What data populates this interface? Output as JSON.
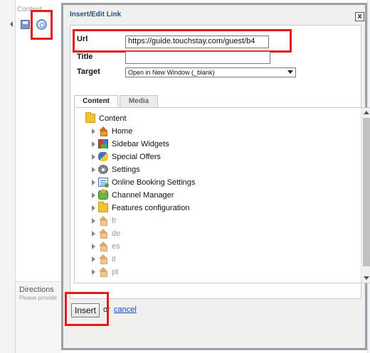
{
  "background": {
    "tab_label": "Content",
    "directions_title": "Directions",
    "directions_hint": "Please provide"
  },
  "dialog": {
    "title": "Insert/Edit Link",
    "close_label": "x",
    "url_label": "Url",
    "url_value": "https://guide.touchstay.com/guest/b4",
    "title_label": "Title",
    "title_value": "",
    "target_label": "Target",
    "target_value": "Open in New Window (_blank)",
    "tabs": [
      {
        "label": "Content",
        "active": true
      },
      {
        "label": "Media",
        "active": false
      }
    ],
    "tree": {
      "root": {
        "label": "Content",
        "icon": "folder-icon"
      },
      "items": [
        {
          "label": "Home",
          "icon": "home-icon",
          "dim": false
        },
        {
          "label": "Sidebar Widgets",
          "icon": "widgets-icon",
          "dim": false
        },
        {
          "label": "Special Offers",
          "icon": "python-icon",
          "dim": false
        },
        {
          "label": "Settings",
          "icon": "gear-icon",
          "dim": false
        },
        {
          "label": "Online Booking Settings",
          "icon": "booking-icon",
          "dim": false
        },
        {
          "label": "Channel Manager",
          "icon": "channel-icon",
          "dim": false
        },
        {
          "label": "Features configuration",
          "icon": "folder-icon",
          "dim": false
        },
        {
          "label": "fr",
          "icon": "home-icon",
          "dim": true
        },
        {
          "label": "de",
          "icon": "home-icon",
          "dim": true
        },
        {
          "label": "es",
          "icon": "home-icon",
          "dim": true
        },
        {
          "label": "it",
          "icon": "home-icon",
          "dim": true
        },
        {
          "label": "pt",
          "icon": "home-icon",
          "dim": true
        }
      ]
    },
    "insert_label": "Insert",
    "or_text": "or",
    "cancel_label": "cancel"
  },
  "colors": {
    "highlight": "#e21b1b",
    "title": "#2b4f7a",
    "link": "#1a3fd8"
  }
}
